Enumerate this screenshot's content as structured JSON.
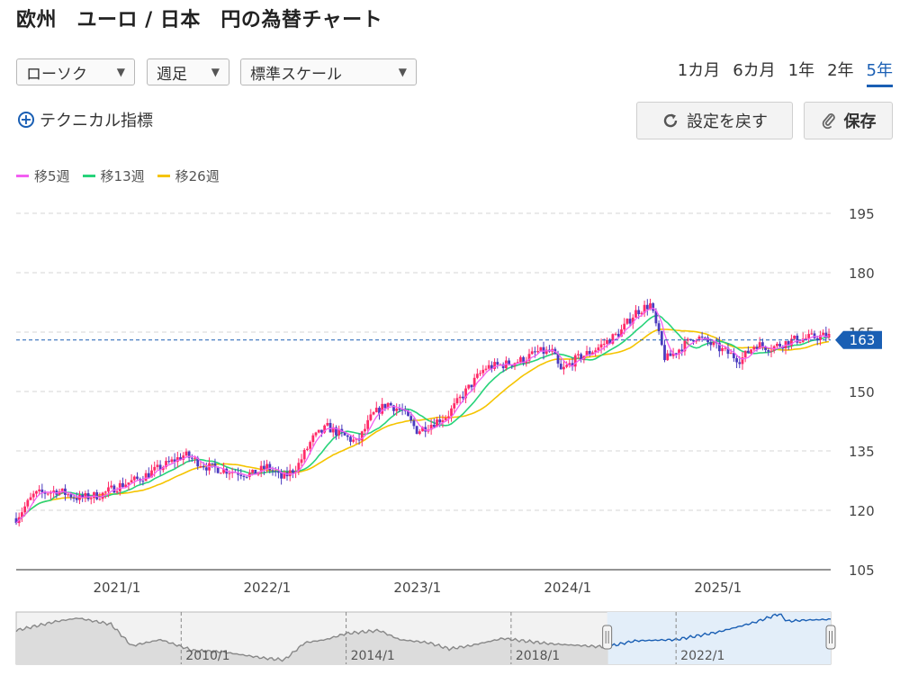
{
  "title": "欧州　ユーロ / 日本　円の為替チャート",
  "controls": {
    "chart_type": "ローソク",
    "interval": "週足",
    "scale": "標準スケール",
    "periods": [
      "1カ月",
      "6カ月",
      "1年",
      "2年",
      "5年"
    ],
    "active_period": "5年",
    "technical": "テクニカル指標",
    "reset": "設定を戻す",
    "save": "保存"
  },
  "colors": {
    "ma5": "#f35ff2",
    "ma13": "#27d37a",
    "ma26": "#f5c400",
    "up": "#ff2a68",
    "down": "#4b3bbf",
    "accent": "#1a5fb4"
  },
  "chart_data": {
    "type": "candlestick",
    "legend": [
      {
        "name": "移5週",
        "color": "#f35ff2"
      },
      {
        "name": "移13週",
        "color": "#27d37a"
      },
      {
        "name": "移26週",
        "color": "#f5c400"
      }
    ],
    "ylim": [
      105,
      200
    ],
    "yticks": [
      195,
      180,
      165,
      150,
      135,
      120,
      105
    ],
    "xlim": [
      2020.33,
      2025.75
    ],
    "xticks": [
      {
        "label": "2021/1",
        "value": 2021.0
      },
      {
        "label": "2022/1",
        "value": 2022.0
      },
      {
        "label": "2023/1",
        "value": 2023.0
      },
      {
        "label": "2024/1",
        "value": 2024.0
      },
      {
        "label": "2025/1",
        "value": 2025.0
      }
    ],
    "current_price": 163,
    "price_path": [
      [
        2020.33,
        118
      ],
      [
        2020.45,
        124
      ],
      [
        2020.6,
        125
      ],
      [
        2020.75,
        123
      ],
      [
        2020.9,
        124
      ],
      [
        2021.0,
        126
      ],
      [
        2021.15,
        128
      ],
      [
        2021.3,
        131
      ],
      [
        2021.45,
        134
      ],
      [
        2021.6,
        131
      ],
      [
        2021.75,
        130
      ],
      [
        2021.9,
        129
      ],
      [
        2022.0,
        131
      ],
      [
        2022.1,
        128
      ],
      [
        2022.2,
        131
      ],
      [
        2022.3,
        138
      ],
      [
        2022.4,
        141
      ],
      [
        2022.5,
        139
      ],
      [
        2022.6,
        137
      ],
      [
        2022.7,
        144
      ],
      [
        2022.8,
        147
      ],
      [
        2022.9,
        145
      ],
      [
        2023.0,
        140
      ],
      [
        2023.1,
        142
      ],
      [
        2023.2,
        144
      ],
      [
        2023.3,
        149
      ],
      [
        2023.45,
        156
      ],
      [
        2023.6,
        157
      ],
      [
        2023.7,
        158
      ],
      [
        2023.8,
        160
      ],
      [
        2023.9,
        160
      ],
      [
        2023.95,
        155
      ],
      [
        2024.05,
        158
      ],
      [
        2024.2,
        161
      ],
      [
        2024.35,
        165
      ],
      [
        2024.45,
        170
      ],
      [
        2024.55,
        172
      ],
      [
        2024.6,
        165
      ],
      [
        2024.65,
        158
      ],
      [
        2024.75,
        161
      ],
      [
        2024.85,
        164
      ],
      [
        2024.95,
        162
      ],
      [
        2025.05,
        160
      ],
      [
        2025.15,
        158
      ],
      [
        2025.25,
        162
      ],
      [
        2025.35,
        161
      ],
      [
        2025.5,
        163
      ],
      [
        2025.7,
        164
      ]
    ],
    "navigator": {
      "labels": [
        {
          "label": "2010/1",
          "value": 2010.0
        },
        {
          "label": "2014/1",
          "value": 2014.0
        },
        {
          "label": "2018/1",
          "value": 2018.0
        },
        {
          "label": "2022/1",
          "value": 2022.0
        }
      ],
      "xlim": [
        2006.0,
        2025.75
      ],
      "ylim": [
        90,
        175
      ],
      "selected": [
        2020.33,
        2025.75
      ],
      "path": [
        [
          2006.0,
          145
        ],
        [
          2007.0,
          160
        ],
        [
          2007.5,
          165
        ],
        [
          2008.3,
          155
        ],
        [
          2008.8,
          120
        ],
        [
          2009.5,
          130
        ],
        [
          2010.3,
          112
        ],
        [
          2011.0,
          110
        ],
        [
          2011.5,
          105
        ],
        [
          2012.0,
          100
        ],
        [
          2012.5,
          97
        ],
        [
          2013.0,
          125
        ],
        [
          2013.5,
          130
        ],
        [
          2014.0,
          140
        ],
        [
          2014.8,
          145
        ],
        [
          2015.3,
          130
        ],
        [
          2016.0,
          125
        ],
        [
          2016.5,
          115
        ],
        [
          2017.0,
          120
        ],
        [
          2017.8,
          132
        ],
        [
          2018.3,
          128
        ],
        [
          2019.0,
          123
        ],
        [
          2019.8,
          120
        ],
        [
          2020.3,
          118
        ],
        [
          2021.0,
          128
        ],
        [
          2022.0,
          130
        ],
        [
          2023.0,
          142
        ],
        [
          2023.9,
          158
        ],
        [
          2024.5,
          172
        ],
        [
          2024.7,
          160
        ],
        [
          2025.2,
          162
        ],
        [
          2025.75,
          163
        ]
      ]
    }
  }
}
